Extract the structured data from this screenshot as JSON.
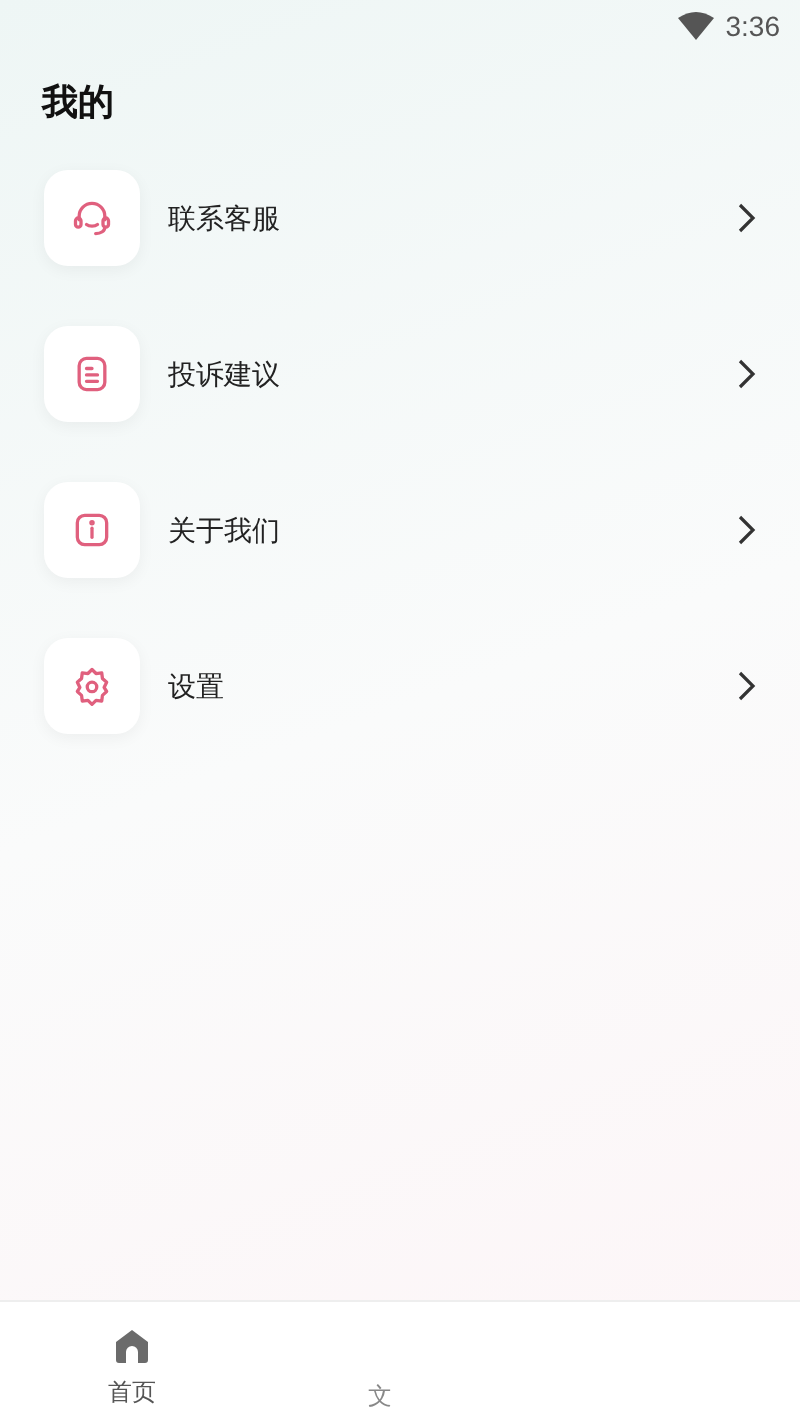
{
  "status_bar": {
    "time": "3:36"
  },
  "title": "我的",
  "menu": [
    {
      "kind": "headset",
      "label": "联系客服"
    },
    {
      "kind": "document",
      "label": "投诉建议"
    },
    {
      "kind": "info",
      "label": "关于我们"
    },
    {
      "kind": "gear",
      "label": "设置"
    }
  ],
  "bottom_nav": [
    {
      "kind": "home",
      "label": "首页",
      "selected": true
    },
    {
      "kind": "hidden",
      "label": "文",
      "selected": false
    }
  ]
}
